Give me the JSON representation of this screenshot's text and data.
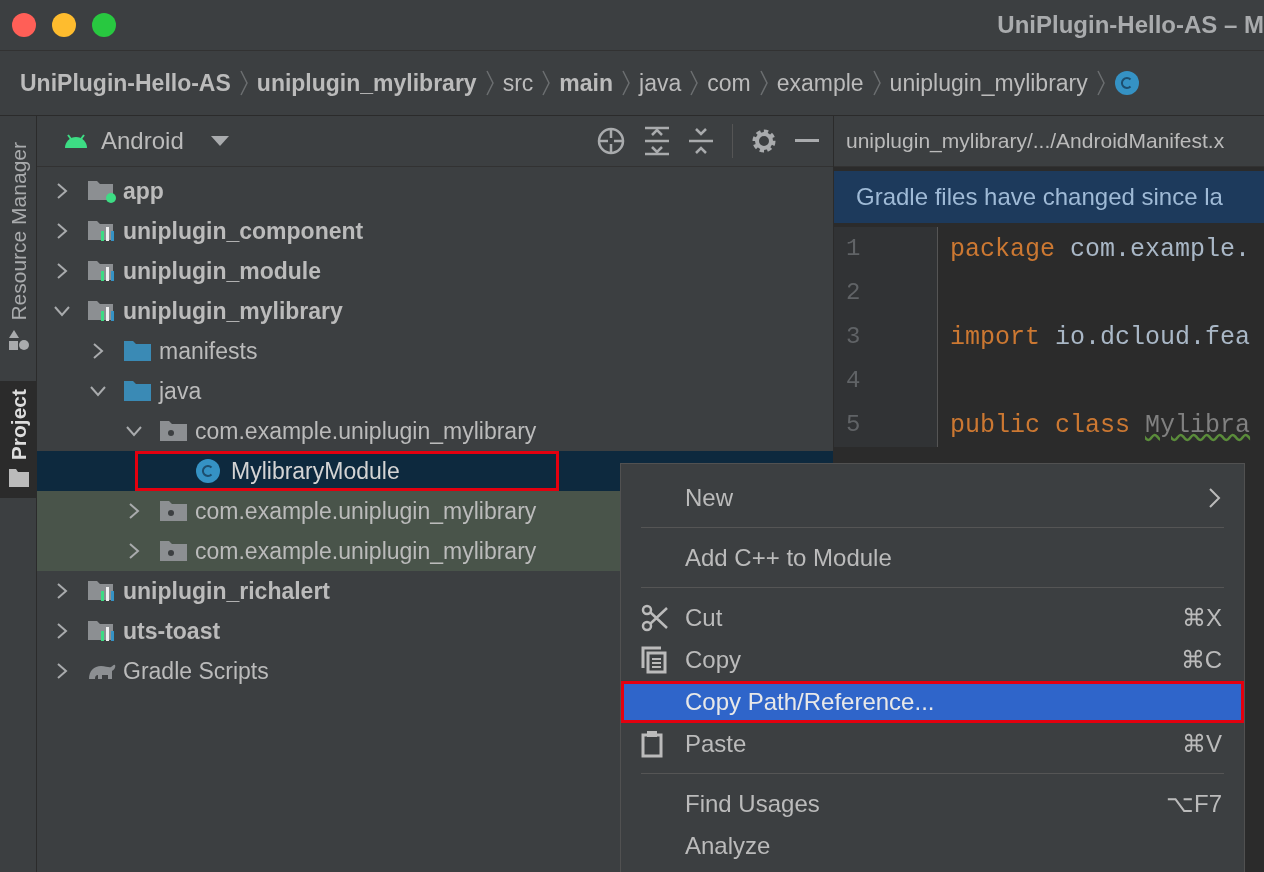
{
  "window": {
    "title": "UniPlugin-Hello-AS – M"
  },
  "breadcrumb": [
    {
      "label": "UniPlugin-Hello-AS",
      "bold": true
    },
    {
      "label": "uniplugin_mylibrary",
      "bold": true
    },
    {
      "label": "src",
      "bold": false
    },
    {
      "label": "main",
      "bold": true
    },
    {
      "label": "java",
      "bold": false
    },
    {
      "label": "com",
      "bold": false
    },
    {
      "label": "example",
      "bold": false
    },
    {
      "label": "uniplugin_mylibrary",
      "bold": false
    },
    {
      "kind": "class"
    }
  ],
  "side_tabs": [
    {
      "label": "Resource Manager",
      "kind": "resources",
      "selected": false
    },
    {
      "label": "Project",
      "kind": "folder",
      "selected": true
    }
  ],
  "project_panel": {
    "view": "Android"
  },
  "tree": [
    {
      "label": "app",
      "kind": "app",
      "bold": true,
      "expanded": false,
      "selected": false,
      "tinted": false
    },
    {
      "label": "uniplugin_component",
      "kind": "module",
      "bold": true,
      "expanded": false,
      "selected": false,
      "tinted": false
    },
    {
      "label": "uniplugin_module",
      "kind": "module",
      "bold": true,
      "expanded": false,
      "selected": false,
      "tinted": false
    },
    {
      "label": "uniplugin_mylibrary",
      "kind": "module",
      "bold": true,
      "expanded": true,
      "selected": false,
      "tinted": false,
      "children": [
        {
          "label": "manifests",
          "kind": "folder",
          "bold": false,
          "expanded": false,
          "selected": false,
          "tinted": false
        },
        {
          "label": "java",
          "kind": "folder",
          "bold": false,
          "expanded": true,
          "selected": false,
          "tinted": false,
          "children": [
            {
              "label": "com.example.uniplugin_mylibrary",
              "kind": "package",
              "bold": false,
              "expanded": true,
              "selected": false,
              "tinted": false,
              "children": [
                {
                  "label": "MylibraryModule",
                  "kind": "class",
                  "bold": false,
                  "selected": true,
                  "tinted": false,
                  "annotated": true
                }
              ]
            },
            {
              "label": "com.example.uniplugin_mylibrary",
              "kind": "package",
              "bold": false,
              "expanded": false,
              "selected": false,
              "tinted": true
            },
            {
              "label": "com.example.uniplugin_mylibrary",
              "kind": "package",
              "bold": false,
              "expanded": false,
              "selected": false,
              "tinted": true
            }
          ]
        }
      ]
    },
    {
      "label": "uniplugin_richalert",
      "kind": "module",
      "bold": true,
      "expanded": false,
      "selected": false,
      "tinted": false
    },
    {
      "label": "uts-toast",
      "kind": "module",
      "bold": true,
      "expanded": false,
      "selected": false,
      "tinted": false
    },
    {
      "label": "Gradle Scripts",
      "kind": "gradle",
      "bold": false,
      "expanded": false,
      "selected": false,
      "tinted": false
    }
  ],
  "editor": {
    "tab": "uniplugin_mylibrary/.../AndroidManifest.x",
    "banner": "Gradle files have changed since la",
    "lines": [
      {
        "number": "1",
        "tokens": [
          {
            "text": "package",
            "kind": "keyword"
          },
          {
            "text": "com.example.",
            "kind": "plain"
          }
        ]
      },
      {
        "number": "2"
      },
      {
        "number": "3",
        "tokens": [
          {
            "text": "import",
            "kind": "keyword"
          },
          {
            "text": "io.dcloud.fea",
            "kind": "plain"
          }
        ]
      },
      {
        "number": "4"
      },
      {
        "number": "5",
        "tokens": [
          {
            "text": "public class",
            "kind": "keyword"
          },
          {
            "text": "Mylibra",
            "kind": "unused"
          }
        ]
      }
    ]
  },
  "context_menu": [
    {
      "kind": "item",
      "label": "New",
      "submenu": true,
      "selected": false
    },
    {
      "kind": "separator"
    },
    {
      "kind": "item",
      "label": "Add C++ to Module",
      "selected": false
    },
    {
      "kind": "separator"
    },
    {
      "kind": "cut",
      "label": "Cut",
      "shortcut": "⌘X",
      "selected": false
    },
    {
      "kind": "copy",
      "label": "Copy",
      "shortcut": "⌘C",
      "selected": false
    },
    {
      "kind": "item",
      "label": "Copy Path/Reference...",
      "selected": true,
      "annotated": true
    },
    {
      "kind": "paste",
      "label": "Paste",
      "shortcut": "⌘V",
      "selected": false
    },
    {
      "kind": "separator"
    },
    {
      "kind": "item",
      "label": "Find Usages",
      "shortcut": "⌥F7",
      "selected": false
    },
    {
      "kind": "item",
      "label": "Analyze",
      "selected": false
    }
  ]
}
